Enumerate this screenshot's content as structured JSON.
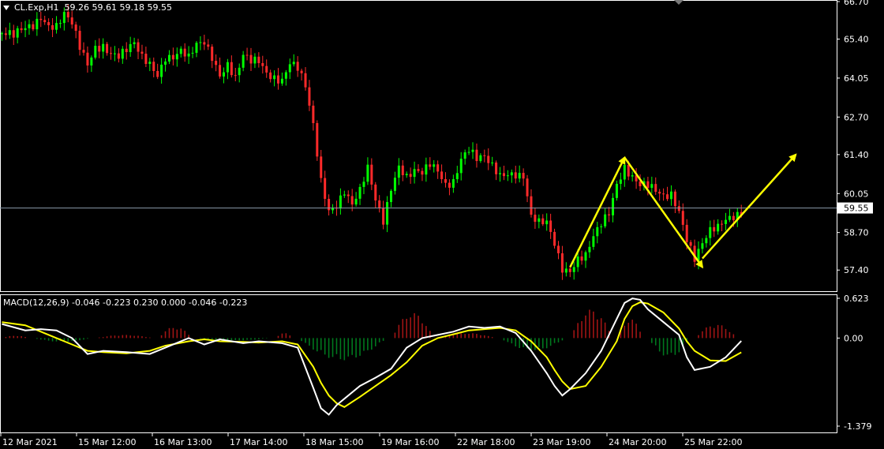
{
  "chart_title": "CL.Exp,H1",
  "ohlc_readout": "59.26 59.61 59.18 59.55",
  "macd_title": "MACD(12,26,9) -0.046 -0.223 0.230 0.000 -0.046 -0.223",
  "current_price": 59.55,
  "current_price_label": "59.55",
  "colors": {
    "bull": "#00ff00",
    "bear": "#ff2a2a",
    "hist_pos": "#a01414",
    "hist_neg": "#00781e",
    "macd": "#ffffff",
    "signal": "#ffff00",
    "arrow": "#ffff00"
  },
  "chart_data": [
    {
      "type": "candlestick",
      "title": "CL.Exp,H1",
      "ylim": [
        56.75,
        66.7
      ],
      "y_ticks": [
        "66.70",
        "65.40",
        "64.05",
        "62.70",
        "61.40",
        "60.05",
        "58.70",
        "57.40"
      ],
      "y_tick_values": [
        66.7,
        65.4,
        64.05,
        62.7,
        61.4,
        60.05,
        58.7,
        57.4
      ],
      "x_tick_labels": [
        "12 Mar 2021",
        "15 Mar 12:00",
        "16 Mar 13:00",
        "17 Mar 14:00",
        "18 Mar 15:00",
        "19 Mar 16:00",
        "22 Mar 18:00",
        "23 Mar 19:00",
        "24 Mar 20:00",
        "25 Mar 22:00"
      ],
      "close_path": [
        [
          0,
          65.6
        ],
        [
          3,
          65.4
        ],
        [
          6,
          65.7
        ],
        [
          8,
          65.9
        ],
        [
          10,
          66.3
        ],
        [
          12,
          66.0
        ],
        [
          14,
          65.9
        ],
        [
          16,
          66.2
        ],
        [
          18,
          65.8
        ],
        [
          20,
          65.0
        ],
        [
          22,
          64.5
        ],
        [
          24,
          65.2
        ],
        [
          26,
          65.3
        ],
        [
          28,
          65.0
        ],
        [
          30,
          64.8
        ],
        [
          32,
          64.9
        ],
        [
          34,
          65.1
        ],
        [
          36,
          64.7
        ],
        [
          38,
          64.6
        ],
        [
          40,
          64.3
        ],
        [
          42,
          64.9
        ],
        [
          44,
          64.8
        ],
        [
          46,
          64.9
        ],
        [
          48,
          64.6
        ],
        [
          50,
          65.1
        ],
        [
          52,
          65.3
        ],
        [
          54,
          64.9
        ],
        [
          56,
          64.3
        ],
        [
          58,
          64.6
        ],
        [
          60,
          64.0
        ],
        [
          62,
          64.7
        ],
        [
          64,
          64.5
        ],
        [
          66,
          64.6
        ],
        [
          68,
          64.3
        ],
        [
          70,
          64.2
        ],
        [
          72,
          64.1
        ],
        [
          74,
          64.6
        ],
        [
          76,
          64.3
        ],
        [
          78,
          63.6
        ],
        [
          80,
          62.3
        ],
        [
          82,
          60.5
        ],
        [
          84,
          59.6
        ],
        [
          86,
          59.8
        ],
        [
          88,
          60.2
        ],
        [
          90,
          59.6
        ],
        [
          92,
          60.0
        ],
        [
          94,
          60.8
        ],
        [
          96,
          59.8
        ],
        [
          98,
          59.2
        ],
        [
          100,
          60.4
        ],
        [
          102,
          61.1
        ],
        [
          104,
          60.6
        ],
        [
          106,
          60.7
        ],
        [
          108,
          60.6
        ],
        [
          110,
          61.0
        ],
        [
          112,
          60.9
        ],
        [
          114,
          60.5
        ],
        [
          116,
          60.6
        ],
        [
          118,
          61.3
        ],
        [
          120,
          61.5
        ],
        [
          122,
          61.1
        ],
        [
          124,
          61.2
        ],
        [
          126,
          61.0
        ],
        [
          128,
          60.8
        ],
        [
          130,
          60.9
        ],
        [
          132,
          60.8
        ],
        [
          134,
          60.6
        ],
        [
          136,
          59.1
        ],
        [
          138,
          58.9
        ],
        [
          140,
          59.0
        ],
        [
          142,
          58.4
        ],
        [
          144,
          57.6
        ],
        [
          146,
          57.5
        ],
        [
          148,
          57.8
        ],
        [
          150,
          57.8
        ],
        [
          152,
          58.4
        ],
        [
          154,
          58.9
        ],
        [
          156,
          59.4
        ],
        [
          158,
          60.5
        ],
        [
          160,
          61.1
        ],
        [
          162,
          60.7
        ],
        [
          164,
          60.3
        ],
        [
          166,
          60.2
        ],
        [
          168,
          60.0
        ],
        [
          170,
          59.9
        ],
        [
          172,
          60.1
        ],
        [
          174,
          59.6
        ],
        [
          176,
          58.6
        ],
        [
          178,
          57.8
        ],
        [
          180,
          58.2
        ],
        [
          182,
          58.6
        ],
        [
          184,
          58.8
        ],
        [
          186,
          59.2
        ],
        [
          188,
          59.4
        ],
        [
          190,
          59.55
        ]
      ],
      "arrows": [
        {
          "from": [
            146,
            57.5
          ],
          "to": [
            160,
            61.3
          ]
        },
        {
          "from": [
            160,
            61.3
          ],
          "to": [
            180,
            57.5
          ]
        },
        {
          "from": [
            180,
            57.8
          ],
          "to": [
            204,
            61.4
          ]
        }
      ]
    },
    {
      "type": "macd",
      "title": "MACD(12,26,9) -0.046 -0.223 0.230 0.000 -0.046 -0.223",
      "ylim": [
        -1.379,
        0.623
      ],
      "y_ticks": [
        "0.623",
        "0.00",
        "-1.379"
      ],
      "y_tick_values": [
        0.623,
        0.0,
        -1.379
      ],
      "main_path": [
        [
          0,
          0.22
        ],
        [
          6,
          0.12
        ],
        [
          10,
          0.14
        ],
        [
          14,
          0.12
        ],
        [
          18,
          0.0
        ],
        [
          22,
          -0.25
        ],
        [
          26,
          -0.2
        ],
        [
          32,
          -0.22
        ],
        [
          38,
          -0.25
        ],
        [
          42,
          -0.15
        ],
        [
          48,
          0.0
        ],
        [
          52,
          -0.1
        ],
        [
          56,
          -0.02
        ],
        [
          62,
          -0.08
        ],
        [
          66,
          -0.05
        ],
        [
          72,
          -0.08
        ],
        [
          76,
          -0.15
        ],
        [
          80,
          -0.78
        ],
        [
          82,
          -1.1
        ],
        [
          84,
          -1.2
        ],
        [
          86,
          -1.05
        ],
        [
          88,
          -0.95
        ],
        [
          92,
          -0.75
        ],
        [
          96,
          -0.62
        ],
        [
          100,
          -0.48
        ],
        [
          104,
          -0.15
        ],
        [
          108,
          0.0
        ],
        [
          112,
          0.05
        ],
        [
          116,
          0.1
        ],
        [
          120,
          0.18
        ],
        [
          124,
          0.16
        ],
        [
          128,
          0.18
        ],
        [
          132,
          0.08
        ],
        [
          136,
          -0.2
        ],
        [
          140,
          -0.55
        ],
        [
          142,
          -0.75
        ],
        [
          144,
          -0.9
        ],
        [
          146,
          -0.8
        ],
        [
          150,
          -0.55
        ],
        [
          154,
          -0.2
        ],
        [
          158,
          0.3
        ],
        [
          160,
          0.55
        ],
        [
          162,
          0.62
        ],
        [
          164,
          0.6
        ],
        [
          166,
          0.45
        ],
        [
          170,
          0.25
        ],
        [
          174,
          0.05
        ],
        [
          176,
          -0.3
        ],
        [
          178,
          -0.5
        ],
        [
          182,
          -0.45
        ],
        [
          186,
          -0.3
        ],
        [
          190,
          -0.046
        ]
      ],
      "signal_path": [
        [
          0,
          0.25
        ],
        [
          6,
          0.2
        ],
        [
          10,
          0.1
        ],
        [
          14,
          0.0
        ],
        [
          18,
          -0.1
        ],
        [
          22,
          -0.2
        ],
        [
          26,
          -0.22
        ],
        [
          32,
          -0.24
        ],
        [
          38,
          -0.2
        ],
        [
          42,
          -0.12
        ],
        [
          48,
          -0.05
        ],
        [
          52,
          -0.02
        ],
        [
          56,
          -0.05
        ],
        [
          62,
          -0.06
        ],
        [
          66,
          -0.07
        ],
        [
          72,
          -0.05
        ],
        [
          76,
          -0.1
        ],
        [
          80,
          -0.45
        ],
        [
          82,
          -0.7
        ],
        [
          84,
          -0.9
        ],
        [
          86,
          -1.02
        ],
        [
          88,
          -1.08
        ],
        [
          92,
          -0.92
        ],
        [
          96,
          -0.75
        ],
        [
          100,
          -0.58
        ],
        [
          104,
          -0.38
        ],
        [
          108,
          -0.12
        ],
        [
          112,
          0.0
        ],
        [
          116,
          0.06
        ],
        [
          120,
          0.12
        ],
        [
          124,
          0.14
        ],
        [
          128,
          0.16
        ],
        [
          132,
          0.12
        ],
        [
          136,
          -0.05
        ],
        [
          140,
          -0.3
        ],
        [
          142,
          -0.5
        ],
        [
          144,
          -0.68
        ],
        [
          146,
          -0.8
        ],
        [
          150,
          -0.75
        ],
        [
          154,
          -0.45
        ],
        [
          158,
          -0.05
        ],
        [
          160,
          0.3
        ],
        [
          162,
          0.5
        ],
        [
          164,
          0.56
        ],
        [
          166,
          0.54
        ],
        [
          170,
          0.4
        ],
        [
          174,
          0.15
        ],
        [
          176,
          -0.05
        ],
        [
          178,
          -0.2
        ],
        [
          182,
          -0.35
        ],
        [
          186,
          -0.36
        ],
        [
          190,
          -0.223
        ]
      ],
      "hist_segments": [
        [
          0,
          8,
          0.04
        ],
        [
          8,
          24,
          -0.06
        ],
        [
          24,
          40,
          0.05
        ],
        [
          40,
          50,
          0.18
        ],
        [
          50,
          70,
          -0.04
        ],
        [
          70,
          76,
          0.08
        ],
        [
          76,
          100,
          -0.35
        ],
        [
          100,
          112,
          0.4
        ],
        [
          112,
          128,
          0.08
        ],
        [
          128,
          146,
          -0.2
        ],
        [
          146,
          158,
          0.45
        ],
        [
          158,
          166,
          0.3
        ],
        [
          166,
          178,
          -0.3
        ],
        [
          178,
          190,
          0.22
        ]
      ]
    }
  ]
}
